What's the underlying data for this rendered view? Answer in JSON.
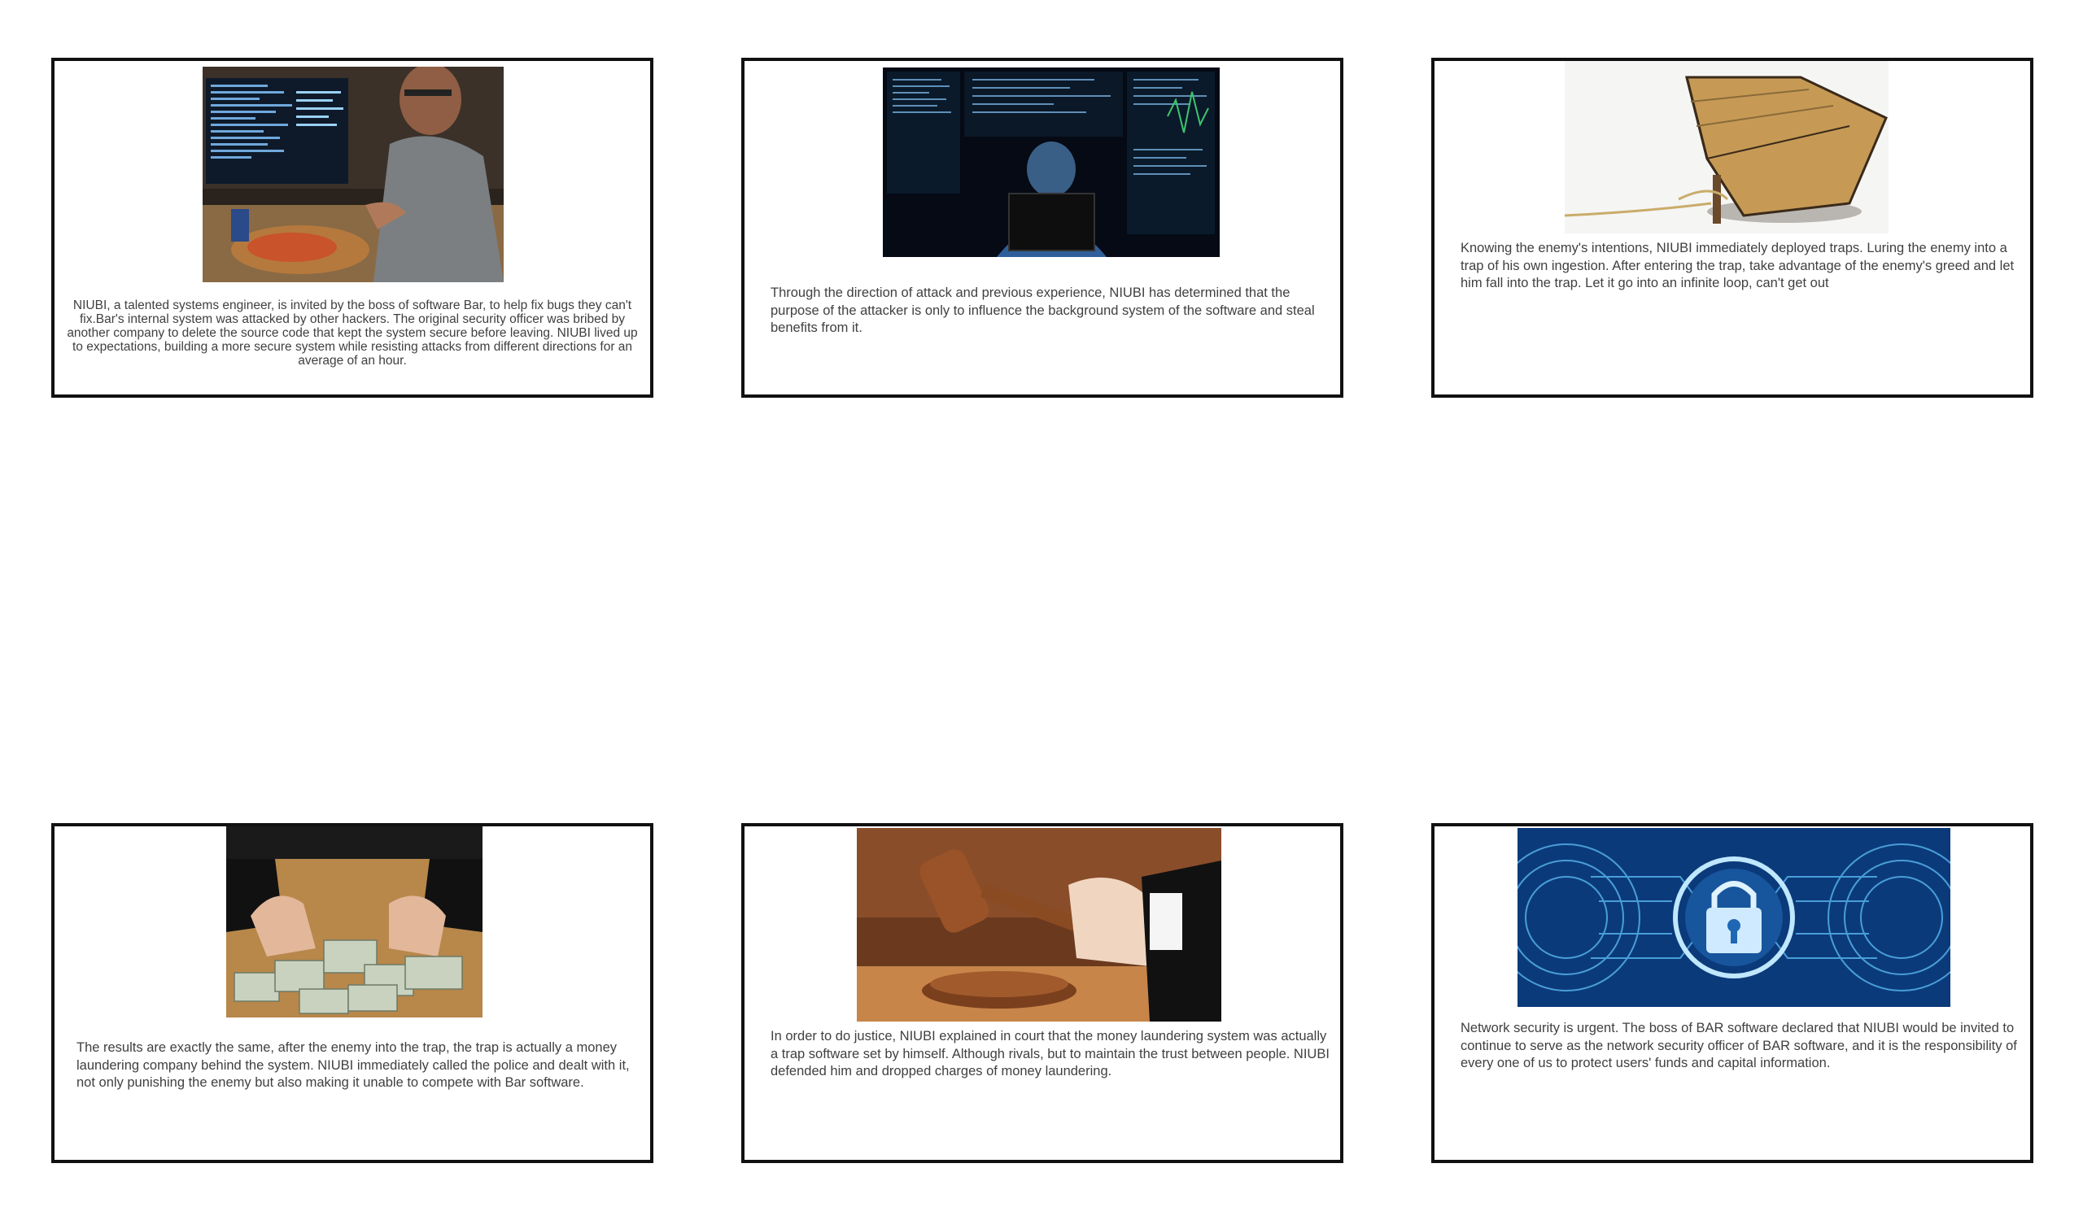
{
  "panels": [
    {
      "caption": "NIUBI, a talented systems engineer, is invited by the boss of software Bar, to help fix bugs they can't fix.Bar's internal system was attacked by other hackers. The original security officer was bribed by another company to delete the source code that kept the system secure before leaving. NIUBI lived up to expectations, building a more secure system while resisting attacks from different directions for an average of an hour."
    },
    {
      "caption": "Through the direction of attack and previous experience, NIUBI has determined that the purpose of the attacker is only to influence the background system of the software and steal benefits from it."
    },
    {
      "caption": "Knowing the enemy's intentions, NIUBI immediately deployed traps. Luring the enemy into a trap of his own ingestion. After entering the trap, take advantage of the enemy's greed and let him fall into the trap. Let it go into an infinite loop, can't get out"
    },
    {
      "caption": "The results are exactly the same, after the enemy into the trap, the trap is actually a money laundering company behind the system. NIUBI immediately called the police and dealt with it, not only punishing the enemy but also making it unable to compete with Bar software."
    },
    {
      "caption": "In order to do justice, NIUBI explained in court that the money laundering system was actually a trap software set by himself. Although rivals, but to maintain the trust between people. NIUBI defended him and dropped charges of money laundering."
    },
    {
      "caption": "Network security is urgent. The boss of BAR software declared that NIUBI would be invited to continue to serve as the network security officer of BAR software, and it is the responsibility of every one of us to protect users' funds and capital information."
    }
  ]
}
